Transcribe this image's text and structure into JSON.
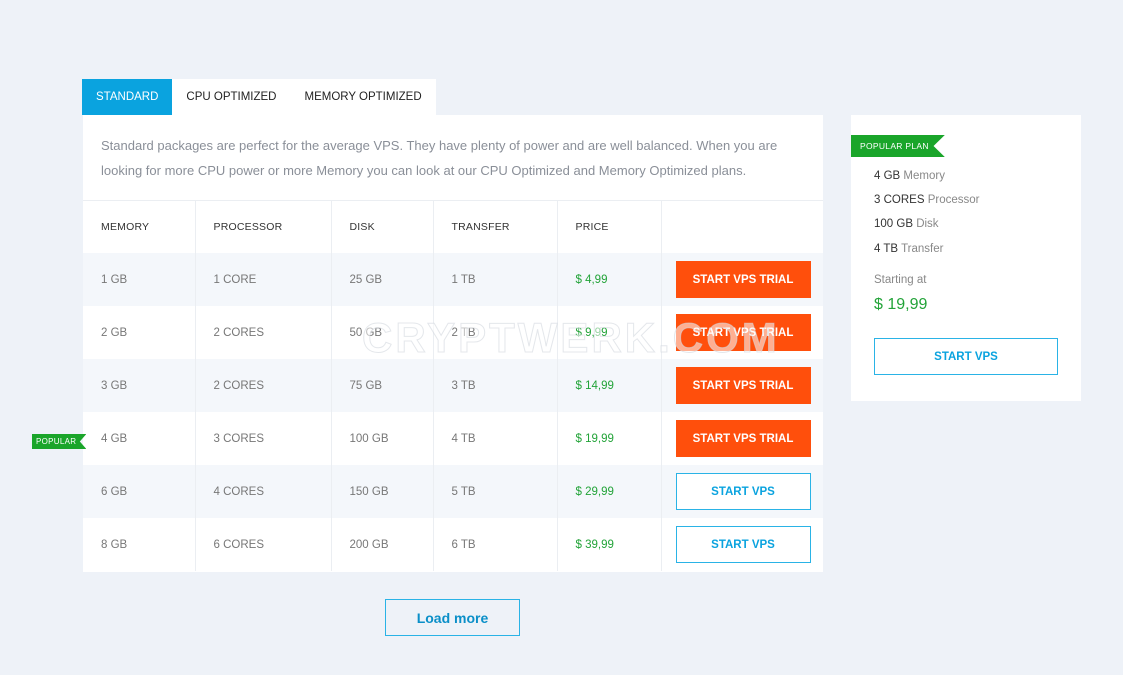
{
  "tabs": [
    {
      "label": "STANDARD",
      "active": true
    },
    {
      "label": "CPU OPTIMIZED",
      "active": false
    },
    {
      "label": "MEMORY OPTIMIZED",
      "active": false
    }
  ],
  "description": "Standard packages are perfect for the average VPS. They have plenty of power and are well balanced. When you are looking for more CPU power or more Memory you can look at our CPU Optimized and Memory Optimized plans.",
  "table": {
    "headers": [
      "MEMORY",
      "PROCESSOR",
      "DISK",
      "TRANSFER",
      "PRICE"
    ],
    "rows": [
      {
        "memory": "1 GB",
        "processor": "1 CORE",
        "disk": "25 GB",
        "transfer": "1 TB",
        "price": "$ 4,99",
        "button": "START VPS TRIAL",
        "button_style": "trial"
      },
      {
        "memory": "2 GB",
        "processor": "2 CORES",
        "disk": "50 GB",
        "transfer": "2 TB",
        "price": "$ 9,99",
        "button": "START VPS TRIAL",
        "button_style": "trial"
      },
      {
        "memory": "3 GB",
        "processor": "2 CORES",
        "disk": "75 GB",
        "transfer": "3 TB",
        "price": "$ 14,99",
        "button": "START VPS TRIAL",
        "button_style": "trial"
      },
      {
        "memory": "4 GB",
        "processor": "3 CORES",
        "disk": "100 GB",
        "transfer": "4 TB",
        "price": "$ 19,99",
        "button": "START VPS TRIAL",
        "button_style": "trial",
        "popular": true
      },
      {
        "memory": "6 GB",
        "processor": "4 CORES",
        "disk": "150 GB",
        "transfer": "5 TB",
        "price": "$ 29,99",
        "button": "START VPS",
        "button_style": "outline"
      },
      {
        "memory": "8 GB",
        "processor": "6 CORES",
        "disk": "200 GB",
        "transfer": "6 TB",
        "price": "$ 39,99",
        "button": "START VPS",
        "button_style": "outline"
      }
    ]
  },
  "popular_badge": "POPULAR",
  "load_more_label": "Load more",
  "side_card": {
    "tag": "POPULAR PLAN",
    "specs": [
      {
        "value": "4 GB",
        "label": " Memory"
      },
      {
        "value": "3 CORES",
        "label": " Processor"
      },
      {
        "value": "100 GB",
        "label": " Disk"
      },
      {
        "value": "4 TB",
        "label": " Transfer"
      }
    ],
    "starting_label": "Starting at",
    "price": "$ 19,99",
    "button_label": "START VPS"
  },
  "watermark": "CRYPTWERK.COM",
  "colors": {
    "accent": "#0aa3df",
    "trial_button": "#ff4f0c",
    "price": "#22a338",
    "badge": "#1aa52a",
    "background": "#eef2f8"
  }
}
